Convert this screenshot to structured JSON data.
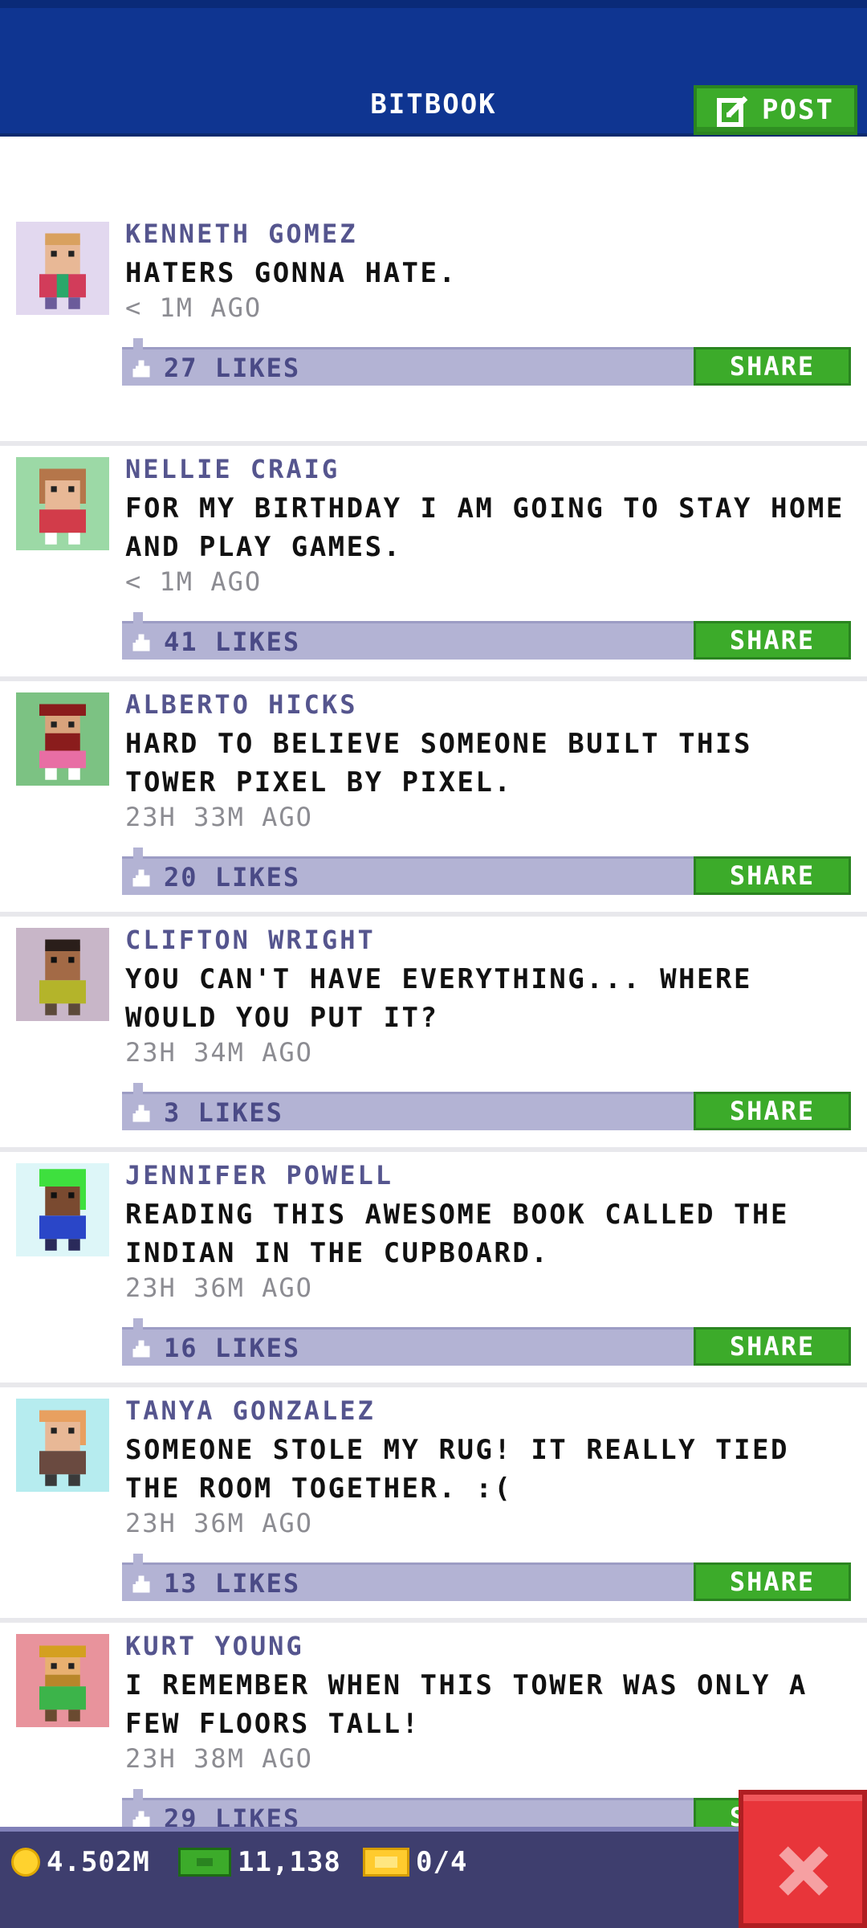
{
  "header": {
    "title": "BITBOOK",
    "post_label": "POST"
  },
  "posts": [
    {
      "name": "KENNETH GOMEZ",
      "text": "HATERS GONNA HATE.",
      "time": "< 1M AGO",
      "likes": "27 LIKES",
      "share": "SHARE",
      "avatar_bg": "#e2d8ef"
    },
    {
      "name": "NELLIE CRAIG",
      "text": "FOR MY BIRTHDAY I AM GOING TO STAY HOME AND PLAY GAMES.",
      "time": "< 1M AGO",
      "likes": "41 LIKES",
      "share": "SHARE",
      "avatar_bg": "#9cd9a6"
    },
    {
      "name": "ALBERTO HICKS",
      "text": "HARD TO BELIEVE SOMEONE BUILT THIS TOWER PIXEL BY PIXEL.",
      "time": "23H 33M AGO",
      "likes": "20 LIKES",
      "share": "SHARE",
      "avatar_bg": "#7cc283"
    },
    {
      "name": "CLIFTON WRIGHT",
      "text": "YOU CAN'T HAVE EVERYTHING... WHERE WOULD YOU PUT IT?",
      "time": "23H 34M AGO",
      "likes": "3 LIKES",
      "share": "SHARE",
      "avatar_bg": "#c8b6c8"
    },
    {
      "name": "JENNIFER POWELL",
      "text": "READING THIS AWESOME BOOK CALLED THE INDIAN IN THE CUPBOARD.",
      "time": "23H 36M AGO",
      "likes": "16 LIKES",
      "share": "SHARE",
      "avatar_bg": "#ddf6f8"
    },
    {
      "name": "TANYA GONZALEZ",
      "text": "SOMEONE STOLE MY RUG! IT REALLY TIED THE ROOM TOGETHER. :(",
      "time": "23H 36M AGO",
      "likes": "13 LIKES",
      "share": "SHARE",
      "avatar_bg": "#b6ecef"
    },
    {
      "name": "KURT YOUNG",
      "text": "I REMEMBER WHEN THIS TOWER WAS ONLY A FEW FLOORS TALL!",
      "time": "23H 38M AGO",
      "likes": "29 LIKES",
      "share": "SHARE",
      "avatar_bg": "#e8939c"
    }
  ],
  "bottom_bar": {
    "coins": "4.502M",
    "bux": "11,138",
    "tickets": "0/4"
  },
  "colors": {
    "header_bg": "#0f3591",
    "accent_green": "#3cab2a",
    "likes_bar": "#b3b3d4",
    "name_color": "#55558e",
    "close_red": "#e8353a"
  }
}
